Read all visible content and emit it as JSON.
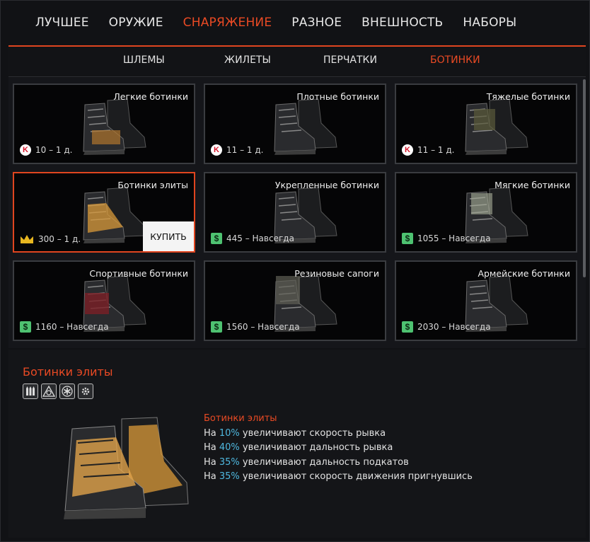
{
  "main_tabs": [
    {
      "label": "ЛУЧШЕЕ",
      "active": false
    },
    {
      "label": "ОРУЖИЕ",
      "active": false
    },
    {
      "label": "СНАРЯЖЕНИЕ",
      "active": true
    },
    {
      "label": "РАЗНОЕ",
      "active": false
    },
    {
      "label": "ВНЕШНОСТЬ",
      "active": false
    },
    {
      "label": "НАБОРЫ",
      "active": false
    }
  ],
  "sub_tabs": [
    {
      "label": "ШЛЕМЫ",
      "active": false
    },
    {
      "label": "ЖИЛЕТЫ",
      "active": false
    },
    {
      "label": "ПЕРЧАТКИ",
      "active": false
    },
    {
      "label": "БОТИНКИ",
      "active": true
    }
  ],
  "items": [
    {
      "name": "Легкие ботинки",
      "currency": "K",
      "price": "10 – 1 д."
    },
    {
      "name": "Плотные ботинки",
      "currency": "K",
      "price": "11 – 1 д."
    },
    {
      "name": "Тяжелые ботинки",
      "currency": "K",
      "price": "11 – 1 д."
    },
    {
      "name": "Ботинки элиты",
      "currency": "crown",
      "price": "300 – 1 д.",
      "selected": true
    },
    {
      "name": "Укрепленные ботинки",
      "currency": "$",
      "price": "445 – Навсегда"
    },
    {
      "name": "Мягкие ботинки",
      "currency": "$",
      "price": "1055 – Навсегда"
    },
    {
      "name": "Спортивные ботинки",
      "currency": "$",
      "price": "1160 – Навсегда"
    },
    {
      "name": "Резиновые сапоги",
      "currency": "$",
      "price": "1560 – Навсегда"
    },
    {
      "name": "Армейские ботинки",
      "currency": "$",
      "price": "2030 – Навсегда"
    }
  ],
  "currency_symbols": {
    "K": "K",
    "$": "$"
  },
  "buy_label": "КУПИТЬ",
  "details": {
    "title": "Ботинки элиты",
    "mod_icons": [
      "ammo-icon",
      "sniper-scope-icon",
      "medic-icon",
      "engineer-icon"
    ],
    "desc_title": "Ботинки элиты",
    "lines": [
      {
        "prefix": "На ",
        "pct": "10%",
        "text": " увеличивают скорость рывка"
      },
      {
        "prefix": "На ",
        "pct": "40%",
        "text": " увеличивают дальность рывка"
      },
      {
        "prefix": "На ",
        "pct": "35%",
        "text": " увеличивают дальность подкатов"
      },
      {
        "prefix": "На ",
        "pct": "35%",
        "text": " увеличивают скорость движения пригнувшись"
      }
    ]
  },
  "colors": {
    "accent": "#ea4a24",
    "percent": "#4fb9e0",
    "dollar": "#4ec271",
    "kcoin": "#d7162b",
    "crown": "#e8b720"
  }
}
